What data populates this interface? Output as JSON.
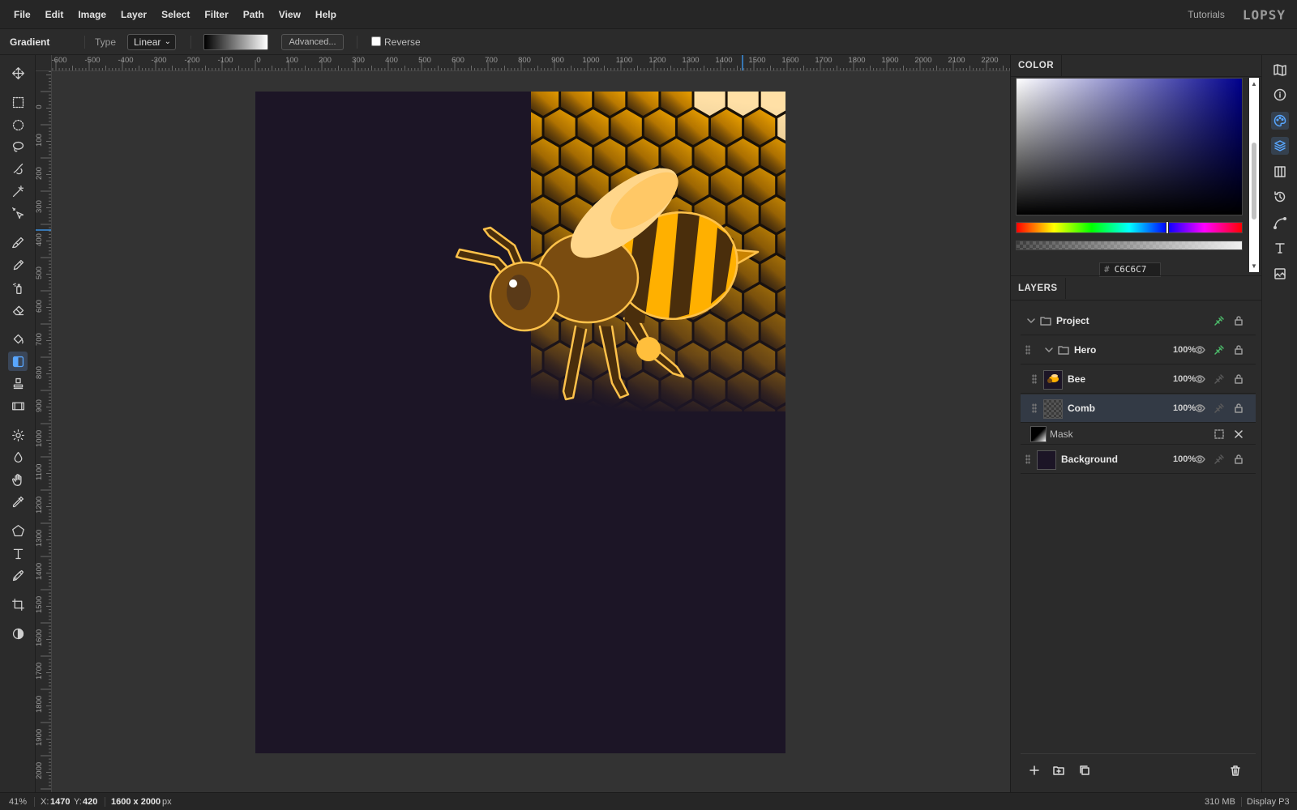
{
  "menu": {
    "items": [
      "File",
      "Edit",
      "Image",
      "Layer",
      "Select",
      "Filter",
      "Path",
      "View",
      "Help"
    ],
    "tutorials": "Tutorials",
    "logo": "LOPSY"
  },
  "options": {
    "tool_name": "Gradient",
    "type_label": "Type",
    "type_value": "Linear",
    "advanced_label": "Advanced...",
    "reverse_label": "Reverse",
    "reverse_checked": false
  },
  "rulers": {
    "horizontal": [
      "-600",
      "-500",
      "-400",
      "-300",
      "-200",
      "-100",
      "0",
      "100",
      "200",
      "300",
      "400",
      "500",
      "600",
      "700",
      "800",
      "900",
      "1000",
      "1100",
      "1200",
      "1300",
      "1400",
      "1500",
      "1600",
      "1700",
      "1800",
      "1900",
      "2000",
      "2100",
      "2200"
    ],
    "vertical": [
      "0",
      "100",
      "200",
      "300",
      "400",
      "500",
      "600",
      "700",
      "800",
      "900",
      "1000",
      "1100",
      "1200",
      "1300",
      "1400",
      "1500",
      "1600",
      "1700",
      "1800",
      "1900",
      "2000"
    ]
  },
  "tools": [
    "move-tool",
    "rect-select-tool",
    "ellipse-select-tool",
    "lasso-tool",
    "quick-select-tool",
    "magic-wand-tool",
    "object-select-tool",
    "brush-tool",
    "pencil-tool",
    "spray-tool",
    "eraser-tool",
    "fill-tool",
    "gradient-tool",
    "stamp-tool",
    "film-tool",
    "dodge-tool",
    "blur-tool",
    "hand-tool",
    "eyedropper-tool",
    "polygon-tool",
    "text-tool",
    "pen-tool",
    "crop-tool",
    "contrast-tool"
  ],
  "active_tool": "gradient-tool",
  "color_panel": {
    "title": "COLOR",
    "hex_symbol": "#",
    "hex_value": "C6C6C7",
    "hue_color": "#00008c"
  },
  "layers_panel": {
    "title": "LAYERS",
    "layers": [
      {
        "name": "Project",
        "opacity": "",
        "type": "group"
      },
      {
        "name": "Hero",
        "opacity": "100%",
        "type": "group"
      },
      {
        "name": "Bee",
        "opacity": "100%",
        "type": "layer"
      },
      {
        "name": "Comb",
        "opacity": "100%",
        "type": "layer",
        "selected": true
      },
      {
        "name": "Mask",
        "opacity": "",
        "type": "mask"
      },
      {
        "name": "Background",
        "opacity": "100%",
        "type": "layer"
      }
    ]
  },
  "status": {
    "zoom": "41%",
    "x_label": "X:",
    "x_value": "1470",
    "y_label": "Y:",
    "y_value": "420",
    "size_value": "1600 x 2000",
    "size_unit": "px",
    "memory": "310 MB",
    "color_profile": "Display P3"
  },
  "colors": {
    "accent": "#58a6ff",
    "canvas_bg": "#1c1526",
    "honey": "#ffb000",
    "green_link": "#4cbb6a"
  }
}
